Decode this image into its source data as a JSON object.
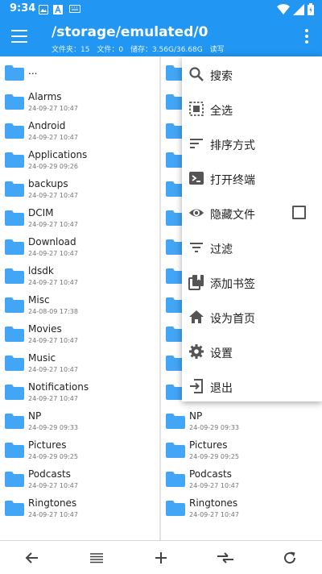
{
  "status_bar": {
    "time": "9:34"
  },
  "header": {
    "path": "/storage/emulated/0",
    "info": [
      "文件夹：15",
      "文件：0",
      "储存：3.56G/36.68G",
      "读写"
    ]
  },
  "left_pane": [
    {
      "name": "...",
      "date": ""
    },
    {
      "name": "Alarms",
      "date": "24-09-27 10:47"
    },
    {
      "name": "Android",
      "date": "24-09-27 10:47"
    },
    {
      "name": "Applications",
      "date": "24-09-29 09:26"
    },
    {
      "name": "backups",
      "date": "24-09-27 10:47"
    },
    {
      "name": "DCIM",
      "date": "24-09-27 10:47"
    },
    {
      "name": "Download",
      "date": "24-09-27 10:47"
    },
    {
      "name": "ldsdk",
      "date": "24-09-27 10:47"
    },
    {
      "name": "Misc",
      "date": "24-08-09 17:38"
    },
    {
      "name": "Movies",
      "date": "24-09-27 10:47"
    },
    {
      "name": "Music",
      "date": "24-09-27 10:47"
    },
    {
      "name": "Notifications",
      "date": "24-09-27 10:47"
    },
    {
      "name": "NP",
      "date": "24-09-29 09:33"
    },
    {
      "name": "Pictures",
      "date": "24-09-29 09:25"
    },
    {
      "name": "Podcasts",
      "date": "24-09-27 10:47"
    },
    {
      "name": "Ringtones",
      "date": "24-09-27 10:47"
    }
  ],
  "right_pane": [
    {
      "name": "NP",
      "date": "24-09-29 09:33"
    },
    {
      "name": "Pictures",
      "date": "24-09-29 09:25"
    },
    {
      "name": "Podcasts",
      "date": "24-09-27 10:47"
    },
    {
      "name": "Ringtones",
      "date": "24-09-27 10:47"
    }
  ],
  "menu": [
    {
      "label": "搜索",
      "icon": "search-icon"
    },
    {
      "label": "全选",
      "icon": "select-all-icon"
    },
    {
      "label": "排序方式",
      "icon": "sort-icon"
    },
    {
      "label": "打开终端",
      "icon": "terminal-icon"
    },
    {
      "label": "隐藏文件",
      "icon": "eye-icon",
      "checked": false
    },
    {
      "label": "过滤",
      "icon": "filter-icon"
    },
    {
      "label": "添加书签",
      "icon": "bookmark-icon"
    },
    {
      "label": "设为首页",
      "icon": "home-icon"
    },
    {
      "label": "设置",
      "icon": "gear-icon"
    },
    {
      "label": "退出",
      "icon": "exit-icon"
    }
  ],
  "bottom_bar": [
    "back-arrow-icon",
    "list-icon",
    "add-icon",
    "swap-icon",
    "refresh-icon"
  ],
  "colors": {
    "primary": "#2196F3",
    "folder": "#42A5F5"
  }
}
